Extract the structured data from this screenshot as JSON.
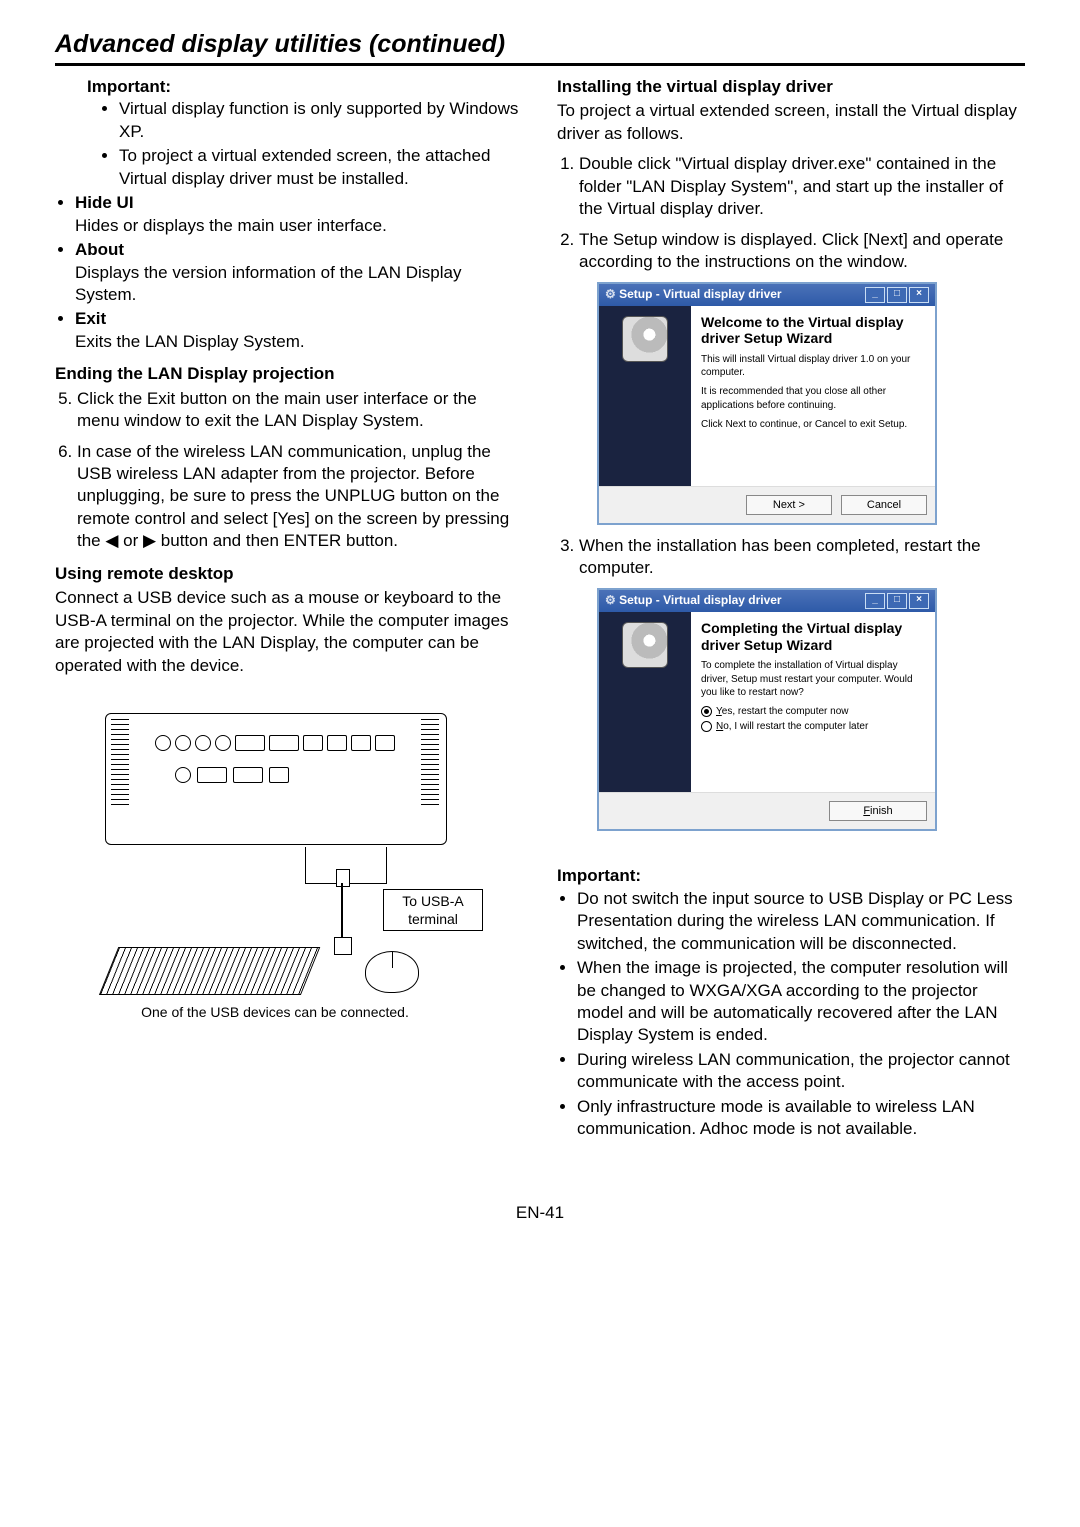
{
  "title": "Advanced display utilities (continued)",
  "left": {
    "important_heading": "Important:",
    "important_items": [
      "Virtual display function is only supported by Windows XP.",
      "To project a virtual extended screen, the attached Virtual display driver must be installed."
    ],
    "menu": [
      {
        "label": "Hide UI",
        "desc": "Hides or displays the main user interface."
      },
      {
        "label": "About",
        "desc": "Displays the version information of the  LAN Display System."
      },
      {
        "label": "Exit",
        "desc": "Exits the LAN Display System."
      }
    ],
    "ending_heading": "Ending the LAN Display projection",
    "ending_steps": [
      "Click the Exit button on the main user interface or the menu window to exit the LAN Display System.",
      "In case of the wireless LAN communication, unplug the USB wireless LAN adapter from the projector. Before unplugging, be sure to press the UNPLUG button on the remote control and select [Yes] on the screen by pressing the ◀ or ▶ button and then ENTER button."
    ],
    "ending_start": 5,
    "remote_heading": "Using remote desktop",
    "remote_body": "Connect a USB device such as a mouse or keyboard to the USB-A terminal on the projector. While the computer images are projected with the LAN Display, the computer can be operated with the device.",
    "usb_label_top": "To USB-A",
    "usb_label_bot": "terminal",
    "caption": "One of the USB devices can be connected."
  },
  "right": {
    "install_heading": "Installing the virtual display driver",
    "install_intro": "To project a virtual extended screen, install the Virtual display driver as follows.",
    "install_steps": [
      "Double click \"Virtual display driver.exe\" contained in the folder \"LAN Display System\", and start up the installer of the Virtual display driver.",
      "The Setup window is displayed. Click [Next] and operate according to the instructions on the window."
    ],
    "dialog1": {
      "title": "Setup - Virtual display driver",
      "heading": "Welcome to the Virtual display driver Setup Wizard",
      "line1": "This will install Virtual display driver 1.0 on your computer.",
      "line2": "It is recommended that you close all other applications before continuing.",
      "line3": "Click Next to continue, or Cancel to exit Setup.",
      "btn_next": "Next >",
      "btn_cancel": "Cancel"
    },
    "step3": "When the installation has been completed, restart the computer.",
    "dialog2": {
      "title": "Setup - Virtual display driver",
      "heading": "Completing the Virtual display driver Setup Wizard",
      "line1": "To complete the installation of Virtual display driver, Setup must restart your computer. Would you like to restart now?",
      "opt1": "Yes, restart the computer now",
      "opt2": "No, I will restart the computer later",
      "btn_finish": "Finish"
    },
    "important_heading": "Important:",
    "important_items": [
      "Do not switch the input source to USB Display or PC Less Presentation during the wireless LAN communication. If switched, the communication will be disconnected.",
      "When the image is projected, the computer resolution will be changed to WXGA/XGA according to the projector model and will be automatically recovered after the LAN Display System is ended.",
      "During wireless LAN communication, the projector cannot communicate with the access point.",
      "Only infrastructure mode is available to wireless LAN communication. Adhoc mode is not available."
    ]
  },
  "page_number": "EN-41"
}
